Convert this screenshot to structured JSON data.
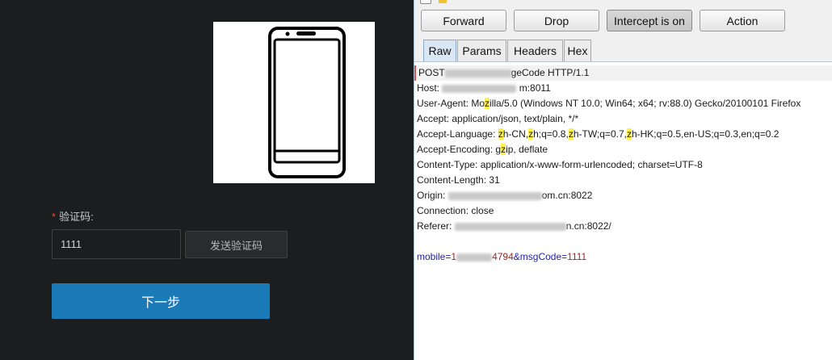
{
  "left_panel": {
    "field_label": "验证码:",
    "required_mark": "*",
    "code_value": "1111",
    "send_code_label": "发送验证码",
    "next_label": "下一步",
    "phone_icon": "smartphone-icon"
  },
  "toolbar": {
    "forward_label": "Forward",
    "drop_label": "Drop",
    "intercept_label": "Intercept is on",
    "action_label": "Action"
  },
  "tabs": [
    {
      "label": "Raw"
    },
    {
      "label": "Params"
    },
    {
      "label": "Headers"
    },
    {
      "label": "Hex"
    }
  ],
  "request": {
    "request_line_method": "POST",
    "request_line_tail": "geCode HTTP/1.1",
    "host_label": "Host:",
    "host_tail": "m:8011",
    "ua_a": "User-Agent: Mo",
    "ua_hl": "z",
    "ua_b": "illa/5.0 (Windows NT 10.0; Win64; x64; rv:88.0) Gecko/20100101 Firefox",
    "accept": "Accept: application/json, text/plain, */*",
    "al_a": "Accept-Language: ",
    "al_h1": "z",
    "al_b": "h-CN,",
    "al_h2": "z",
    "al_c": "h;q=0.8,",
    "al_h3": "z",
    "al_d": "h-TW;q=0.7,",
    "al_h4": "z",
    "al_e": "h-HK;q=0.5,en-US;q=0.3,en;q=0.2",
    "ae_a": "Accept-Encoding: g",
    "ae_hl": "z",
    "ae_b": "ip, deflate",
    "content_type": "Content-Type: application/x-www-form-urlencoded; charset=UTF-8",
    "content_length": "Content-Length: 31",
    "origin_label": "Origin:",
    "origin_tail": "om.cn:8022",
    "connection": "Connection: close",
    "referer_label": "Referer:",
    "referer_tail": "n.cn:8022/",
    "body_mobile_name": "mobile",
    "body_eq1": "=",
    "body_mobile_a": "1",
    "body_mobile_b": "4794",
    "body_amp": "&",
    "body_code_name": "msgCode",
    "body_eq2": "=",
    "body_code_value": "1111"
  }
}
